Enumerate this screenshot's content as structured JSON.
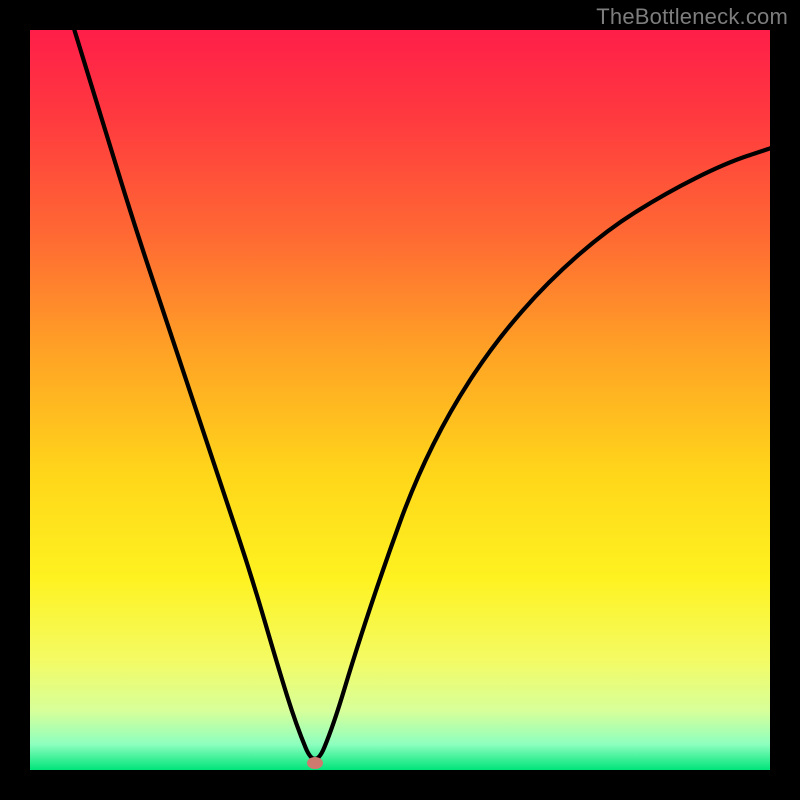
{
  "watermark": "TheBottleneck.com",
  "marker": {
    "x_pct": 38.5,
    "y_pct": 99.0,
    "color": "#cf7a6e"
  },
  "gradient_stops": [
    {
      "offset": 0,
      "color": "#ff1e49"
    },
    {
      "offset": 0.12,
      "color": "#ff3a3f"
    },
    {
      "offset": 0.28,
      "color": "#ff6a33"
    },
    {
      "offset": 0.44,
      "color": "#ffa425"
    },
    {
      "offset": 0.6,
      "color": "#ffd61a"
    },
    {
      "offset": 0.74,
      "color": "#fef220"
    },
    {
      "offset": 0.85,
      "color": "#f4fb63"
    },
    {
      "offset": 0.92,
      "color": "#d7ff9a"
    },
    {
      "offset": 0.965,
      "color": "#8effbf"
    },
    {
      "offset": 1.0,
      "color": "#00e57a"
    }
  ],
  "chart_data": {
    "type": "line",
    "title": "",
    "xlabel": "",
    "ylabel": "",
    "xlim": [
      0,
      100
    ],
    "ylim": [
      0,
      100
    ],
    "series": [
      {
        "name": "bottleneck-curve",
        "x": [
          6,
          10,
          14,
          18,
          22,
          26,
          30,
          33.5,
          36,
          38.5,
          41,
          44,
          48,
          52,
          57,
          63,
          70,
          78,
          86,
          94,
          100
        ],
        "y": [
          100,
          87,
          74,
          62,
          50,
          38,
          26,
          14,
          6,
          0,
          6,
          16,
          28,
          39,
          49,
          58,
          66,
          73,
          78,
          82,
          84
        ]
      }
    ],
    "annotations": [
      {
        "type": "marker",
        "x": 38.5,
        "y": 0,
        "label": "optimal-point"
      }
    ]
  }
}
